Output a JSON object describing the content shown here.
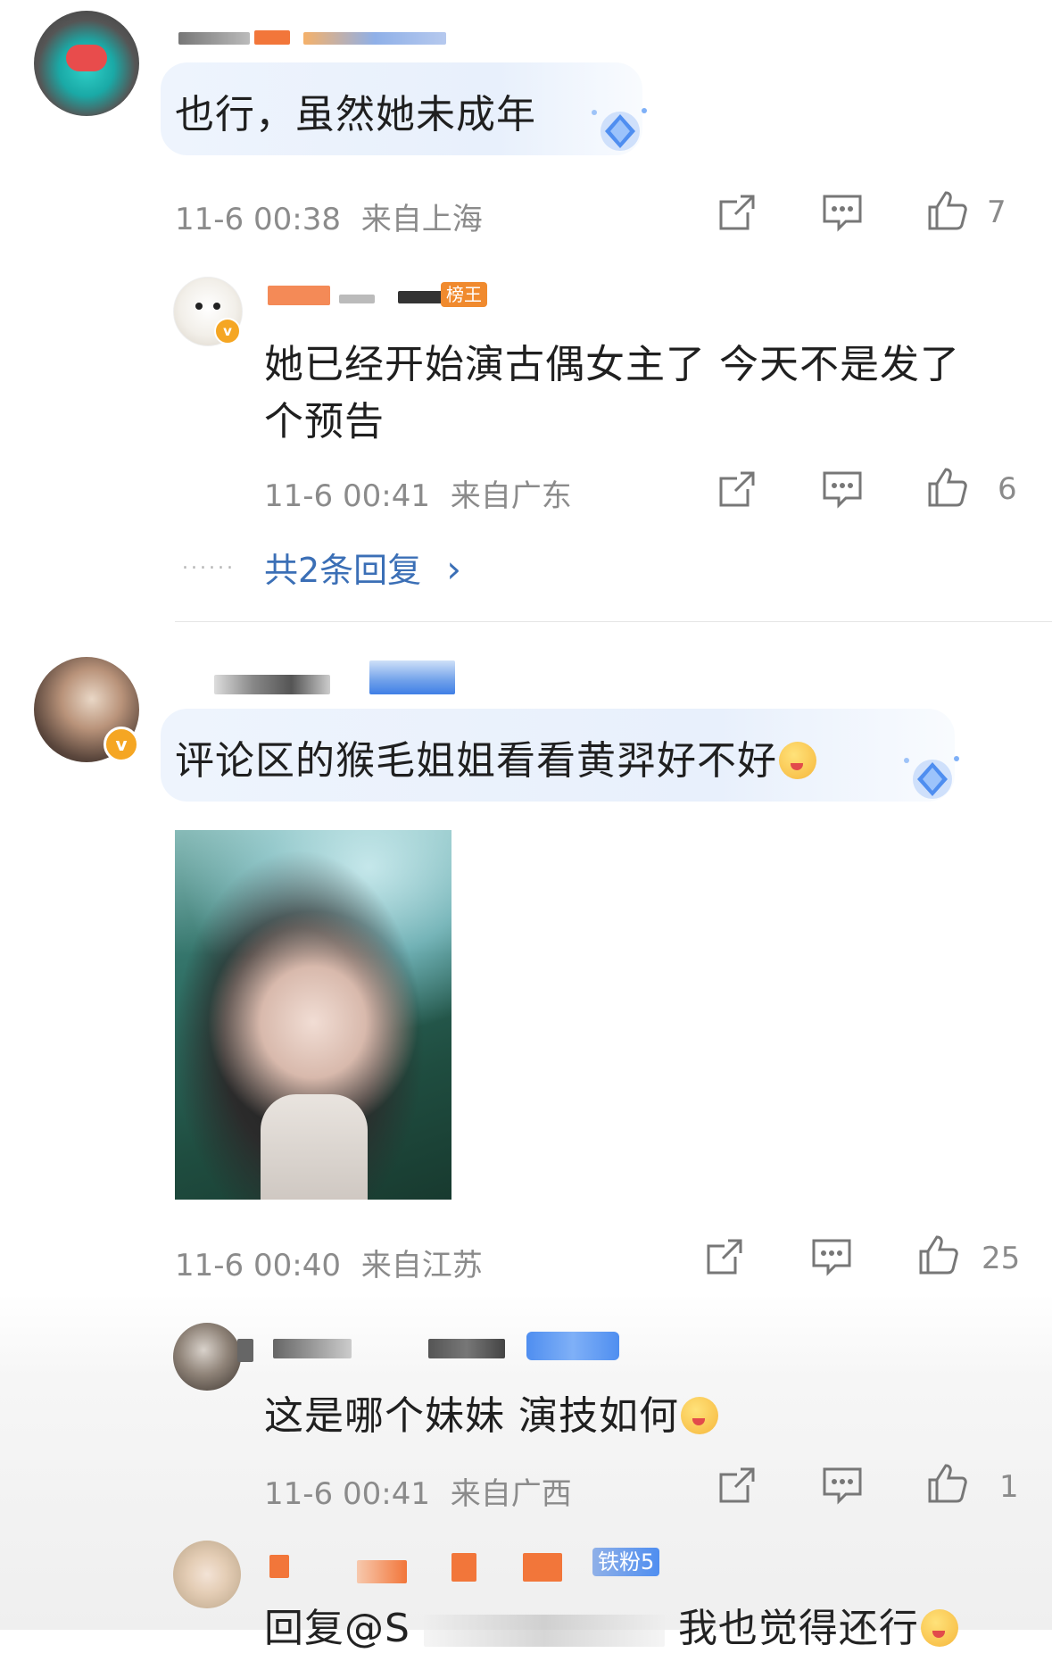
{
  "comments": [
    {
      "text": "也行，虽然她未成年",
      "time": "11-6 00:38",
      "location": "来自上海",
      "likes": "7"
    },
    {
      "text_line1": "她已经开始演古偶女主了 今天不是发了",
      "text_line2": "个预告",
      "time": "11-6 00:41",
      "location": "来自广东",
      "likes": "6",
      "badge": "榜王"
    },
    {
      "replies_link": "共2条回复",
      "replies_chevron": "›",
      "dots": "......"
    },
    {
      "text": "评论区的猴毛姐姐看看黄羿好不好",
      "time": "11-6 00:40",
      "location": "来自江苏",
      "likes": "25"
    },
    {
      "text": "这是哪个妹妹 演技如何",
      "time": "11-6 00:41",
      "location": "来自广西",
      "likes": "1"
    },
    {
      "text": "回复@S",
      "text_tail": "我也觉得还行",
      "badge": "铁粉5"
    }
  ],
  "icons": [
    "share-icon",
    "comment-icon",
    "like-icon",
    "verified-badge-icon",
    "diamond-icon",
    "emoji-icon"
  ],
  "colors": {
    "link_blue": "#3b6fb6",
    "meta_gray": "#8b8b8b",
    "bubble_bg": "#eef4fd",
    "vip_gold": "#f5a623"
  }
}
